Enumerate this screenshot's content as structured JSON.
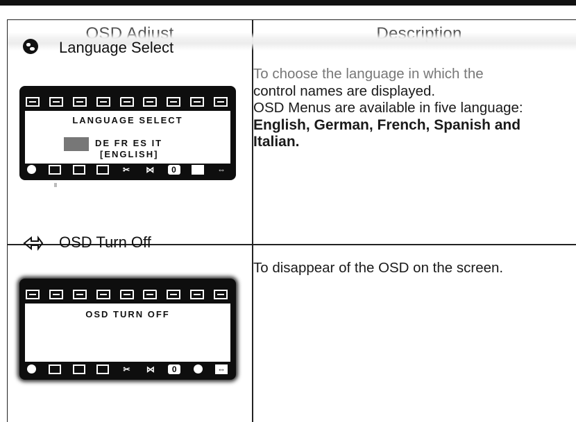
{
  "header": {
    "left": "OSD Adjust",
    "right": "Description"
  },
  "rows": [
    {
      "title": "Language Select",
      "icon": "globe-icon",
      "osd": {
        "label": "LANGUAGE SELECT",
        "languages": "DE   FR   ES   IT",
        "selected": "[ENGLISH]"
      },
      "description": {
        "line1": "To choose the language in which the",
        "line2": "control names are displayed.",
        "line3": "OSD Menus are available in five language:",
        "bold1": "English, German, French, Spanish and",
        "bold2": "Italian."
      }
    },
    {
      "title": "OSD Turn Off",
      "icon": "exit-arrow-icon",
      "osd": {
        "label": "OSD TURN OFF"
      },
      "description": {
        "line1": "To disappear of the OSD on the screen."
      }
    }
  ],
  "colors": {
    "osd_bg": "#0e0e0e",
    "border": "#222222",
    "lang_box": "#777777"
  }
}
